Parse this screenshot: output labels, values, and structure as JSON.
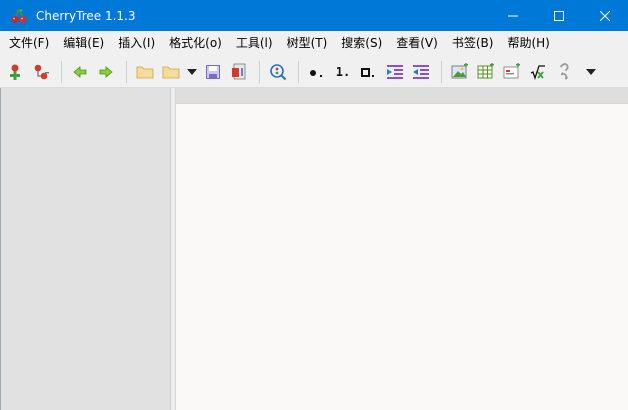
{
  "window": {
    "title": "CherryTree 1.1.3",
    "app_icon": "cherry-icon",
    "controls": [
      "minimize-icon",
      "maximize-icon",
      "close-icon"
    ]
  },
  "menu": [
    {
      "label": "文件(F)"
    },
    {
      "label": "编辑(E)"
    },
    {
      "label": "插入(I)"
    },
    {
      "label": "格式化(o)"
    },
    {
      "label": "工具(l)"
    },
    {
      "label": "树型(T)"
    },
    {
      "label": "搜索(S)"
    },
    {
      "label": "查看(V)"
    },
    {
      "label": "书签(B)"
    },
    {
      "label": "帮助(H)"
    }
  ],
  "toolbar": {
    "icons": [
      "add-node-icon",
      "add-subnode-icon",
      "go-back-icon",
      "go-forward-icon",
      "open-file-icon",
      "open-recent-icon",
      "dropdown-icon",
      "save-icon",
      "export-icon",
      "find-icon",
      "bulleted-list-icon",
      "numbered-list-icon",
      "todo-list-icon",
      "indent-icon",
      "unindent-icon",
      "insert-image-icon",
      "insert-table-icon",
      "insert-codebox-icon",
      "insert-latex-icon",
      "insert-link-icon",
      "more-icon"
    ],
    "numbered_list_glyph": "1.",
    "colors": {
      "green_arrow": "#3aa23a",
      "red_node": "#d23b2b",
      "folder": "#f3d48a",
      "purple_save": "#7a6bc4",
      "list_purple": "#8a4fd0"
    }
  },
  "colors": {
    "titlebar": "#0078d7",
    "tree_panel": "#e1e1e1",
    "editor": "#faf9f8"
  }
}
